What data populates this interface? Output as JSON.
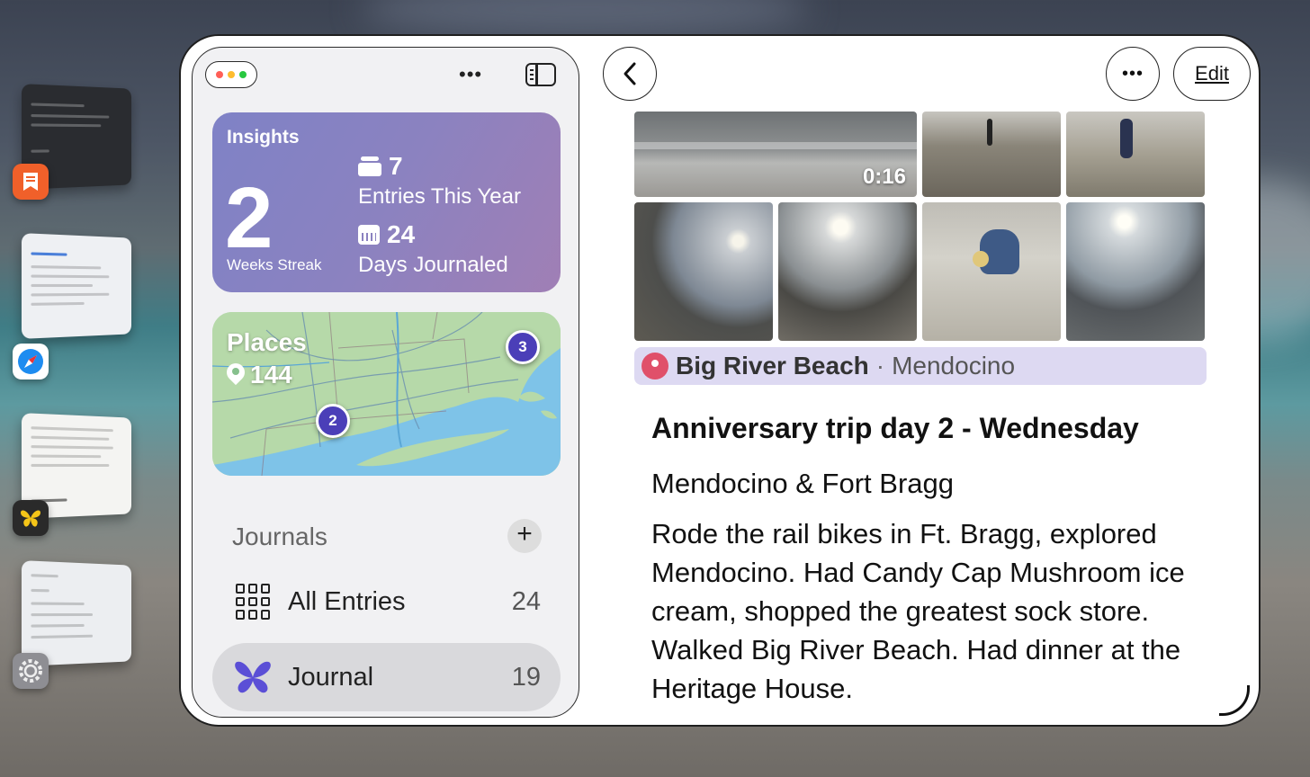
{
  "sidebar": {
    "more_label": "•••",
    "insights": {
      "title": "Insights",
      "streak_value": "2",
      "streak_label": "Weeks Streak",
      "entries_value": "7",
      "entries_label": "Entries This Year",
      "days_value": "24",
      "days_label": "Days Journaled"
    },
    "places": {
      "title": "Places",
      "count": "144",
      "markers": [
        "3",
        "2"
      ]
    },
    "journals": {
      "header": "Journals",
      "add_label": "+",
      "items": [
        {
          "label": "All Entries",
          "count": "24",
          "icon": "grid-icon"
        },
        {
          "label": "Journal",
          "count": "19",
          "icon": "butterfly-icon"
        }
      ]
    }
  },
  "detail": {
    "back_label": "‹",
    "more_label": "•••",
    "edit_label": "Edit",
    "video_duration": "0:16",
    "location": {
      "name": "Big River Beach",
      "separator": "·",
      "city": "Mendocino"
    },
    "entry": {
      "title": "Anniversary trip day 2 - Wednesday",
      "subtitle": "Mendocino & Fort Bragg",
      "body": "Rode the rail bikes in Ft. Bragg, explored Mendocino. Had Candy Cap Mushroom ice cream, shopped the greatest sock store. Walked Big River Beach. Had dinner at the Heritage House."
    }
  },
  "colors": {
    "insights_bg": "#8b82c0",
    "marker": "#4b3fb8",
    "location_bar": "#ddd9f2",
    "location_pin": "#e0506a"
  }
}
